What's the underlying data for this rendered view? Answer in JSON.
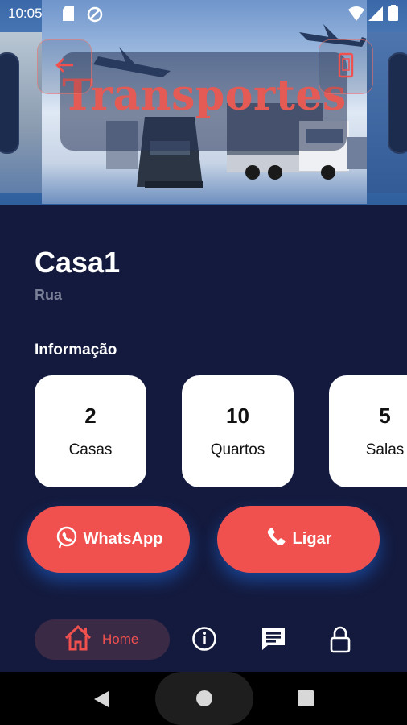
{
  "status_bar": {
    "time": "10:05"
  },
  "banner": {
    "title": "Transportes"
  },
  "property": {
    "name": "Casa1",
    "street": "Rua"
  },
  "info": {
    "heading": "Informação",
    "cards": [
      {
        "value": "2",
        "label": "Casas"
      },
      {
        "value": "10",
        "label": "Quartos"
      },
      {
        "value": "5",
        "label": "Salas"
      }
    ]
  },
  "actions": {
    "whatsapp": "WhatsApp",
    "call": "Ligar"
  },
  "nav": {
    "home": "Home"
  },
  "colors": {
    "accent": "#f0514f",
    "background": "#141a3d",
    "card": "#ffffff"
  }
}
